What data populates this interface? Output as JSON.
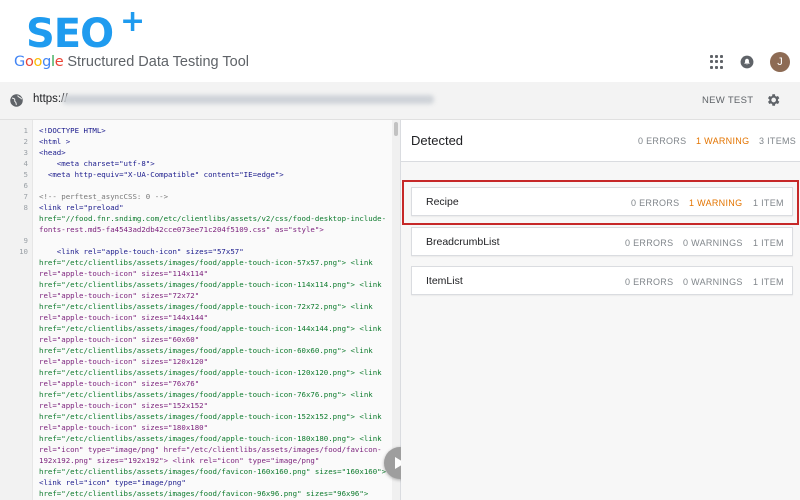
{
  "header": {
    "logo_text": "SEO",
    "logo_plus": "+",
    "google_word": [
      "G",
      "o",
      "o",
      "g",
      "l",
      "e"
    ],
    "tool_name": "Structured Data Testing Tool",
    "avatar_initial": "J",
    "icons": [
      "apps-grid-icon",
      "bell-icon",
      "avatar"
    ]
  },
  "urlbar": {
    "icon": "globe-icon",
    "url_prefix": "https://",
    "new_test_label": "NEW TEST",
    "settings_icon": "gear-icon"
  },
  "code": {
    "lines": [
      {
        "num": "1",
        "text": "<!DOCTYPE HTML>"
      },
      {
        "num": "2",
        "text": "<html >"
      },
      {
        "num": "3",
        "text": "<head>"
      },
      {
        "num": "4",
        "text": "    <meta charset=\"utf-8\">"
      },
      {
        "num": "5",
        "text": "  <meta http-equiv=\"X-UA-Compatible\" content=\"IE=edge\">"
      },
      {
        "num": "6",
        "text": ""
      },
      {
        "num": "7",
        "text": "<!-- perftest_asyncCSS: 0 -->"
      },
      {
        "num": "8",
        "text": "<link rel=\"preload\""
      },
      {
        "num": "",
        "text": "href=\"//food.fnr.sndimg.com/etc/clientlibs/assets/v2/css/food-desktop-include-"
      },
      {
        "num": "",
        "text": "fonts-rest.md5-fa4543ad2db42cce073ee71c204f5109.css\" as=\"style\">"
      },
      {
        "num": "9",
        "text": ""
      },
      {
        "num": "10",
        "text": "    <link rel=\"apple-touch-icon\" sizes=\"57x57\""
      },
      {
        "num": "",
        "text": "href=\"/etc/clientlibs/assets/images/food/apple-touch-icon-57x57.png\"> <link"
      },
      {
        "num": "",
        "text": "rel=\"apple-touch-icon\" sizes=\"114x114\""
      },
      {
        "num": "",
        "text": "href=\"/etc/clientlibs/assets/images/food/apple-touch-icon-114x114.png\"> <link"
      },
      {
        "num": "",
        "text": "rel=\"apple-touch-icon\" sizes=\"72x72\""
      },
      {
        "num": "",
        "text": "href=\"/etc/clientlibs/assets/images/food/apple-touch-icon-72x72.png\"> <link"
      },
      {
        "num": "",
        "text": "rel=\"apple-touch-icon\" sizes=\"144x144\""
      },
      {
        "num": "",
        "text": "href=\"/etc/clientlibs/assets/images/food/apple-touch-icon-144x144.png\"> <link"
      },
      {
        "num": "",
        "text": "rel=\"apple-touch-icon\" sizes=\"60x60\""
      },
      {
        "num": "",
        "text": "href=\"/etc/clientlibs/assets/images/food/apple-touch-icon-60x60.png\"> <link"
      },
      {
        "num": "",
        "text": "rel=\"apple-touch-icon\" sizes=\"120x120\""
      },
      {
        "num": "",
        "text": "href=\"/etc/clientlibs/assets/images/food/apple-touch-icon-120x120.png\"> <link"
      },
      {
        "num": "",
        "text": "rel=\"apple-touch-icon\" sizes=\"76x76\""
      },
      {
        "num": "",
        "text": "href=\"/etc/clientlibs/assets/images/food/apple-touch-icon-76x76.png\"> <link"
      },
      {
        "num": "",
        "text": "rel=\"apple-touch-icon\" sizes=\"152x152\""
      },
      {
        "num": "",
        "text": "href=\"/etc/clientlibs/assets/images/food/apple-touch-icon-152x152.png\"> <link"
      },
      {
        "num": "",
        "text": "rel=\"apple-touch-icon\" sizes=\"180x180\""
      },
      {
        "num": "",
        "text": "href=\"/etc/clientlibs/assets/images/food/apple-touch-icon-180x180.png\"> <link"
      },
      {
        "num": "",
        "text": "rel=\"icon\" type=\"image/png\" href=\"/etc/clientlibs/assets/images/food/favicon-"
      },
      {
        "num": "",
        "text": "192x192.png\" sizes=\"192x192\"> <link rel=\"icon\" type=\"image/png\""
      },
      {
        "num": "",
        "text": "href=\"/etc/clientlibs/assets/images/food/favicon-160x160.png\" sizes=\"160x160\">"
      },
      {
        "num": "",
        "text": "<link rel=\"icon\" type=\"image/png\""
      },
      {
        "num": "",
        "text": "href=\"/etc/clientlibs/assets/images/food/favicon-96x96.png\" sizes=\"96x96\">"
      }
    ]
  },
  "results": {
    "title": "Detected",
    "summary": {
      "errors": "0 ERRORS",
      "warnings": "1 WARNING",
      "items": "3 ITEMS"
    },
    "cards": [
      {
        "name": "Recipe",
        "errors": "0 ERRORS",
        "warnings": "1 WARNING",
        "items": "1 ITEM",
        "has_warning": true
      },
      {
        "name": "BreadcrumbList",
        "errors": "0 ERRORS",
        "warnings": "0 WARNINGS",
        "items": "1 ITEM",
        "has_warning": false
      },
      {
        "name": "ItemList",
        "errors": "0 ERRORS",
        "warnings": "0 WARNINGS",
        "items": "1 ITEM",
        "has_warning": false
      }
    ]
  },
  "colors": {
    "brand": "#1f9bef",
    "warning": "#e37400",
    "highlight": "#c62828"
  }
}
